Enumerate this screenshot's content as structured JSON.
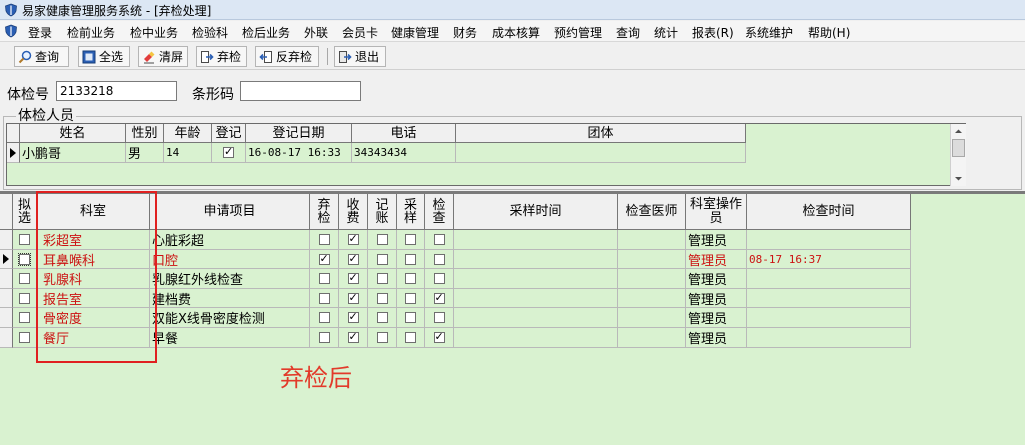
{
  "window": {
    "title": "易家健康管理服务系统 - [弃检处理]"
  },
  "menu": [
    "登录",
    "检前业务",
    "检中业务",
    "检验科",
    "检后业务",
    "外联",
    "会员卡",
    "健康管理",
    "财务",
    "成本核算",
    "预约管理",
    "查询",
    "统计",
    "报表(R)",
    "系统维护",
    "帮助(H)"
  ],
  "toolbar": {
    "query": "查询",
    "select_all": "全选",
    "clear": "清屏",
    "abandon": "弃检",
    "unabandon": "反弃检",
    "exit": "退出"
  },
  "search": {
    "exam_no_label": "体检号",
    "exam_no_value": "2133218",
    "barcode_label": "条形码",
    "barcode_value": ""
  },
  "patients": {
    "group_title": "体检人员",
    "headers": [
      "姓名",
      "性别",
      "年龄",
      "登记",
      "登记日期",
      "电话",
      "团体"
    ],
    "rows": [
      {
        "name": "小鹏哥",
        "gender": "男",
        "age": "14",
        "registered": true,
        "reg_date": "16-08-17 16:33",
        "phone": "34343434",
        "group": ""
      }
    ]
  },
  "items": {
    "headers": [
      "拟选",
      "科室",
      "申请项目",
      "弃检",
      "收费",
      "记账",
      "采样",
      "检查",
      "采样时间",
      "检查医师",
      "科室操作员",
      "检查时间"
    ],
    "rows": [
      {
        "selected": false,
        "dept": "彩超室",
        "item": "心脏彩超",
        "abandoned": false,
        "charged": true,
        "billed": false,
        "sampled": false,
        "checked": false,
        "sample_time": "",
        "doctor": "",
        "operator": "管理员",
        "check_time": "",
        "current": false
      },
      {
        "selected": false,
        "dept": "耳鼻喉科",
        "item": "口腔",
        "abandoned": true,
        "charged": true,
        "billed": false,
        "sampled": false,
        "checked": false,
        "sample_time": "",
        "doctor": "",
        "operator": "管理员",
        "check_time": "08-17 16:37",
        "current": true
      },
      {
        "selected": false,
        "dept": "乳腺科",
        "item": "乳腺红外线检查",
        "abandoned": false,
        "charged": true,
        "billed": false,
        "sampled": false,
        "checked": false,
        "sample_time": "",
        "doctor": "",
        "operator": "管理员",
        "check_time": "",
        "current": false
      },
      {
        "selected": false,
        "dept": "报告室",
        "item": "建档费",
        "abandoned": false,
        "charged": true,
        "billed": false,
        "sampled": false,
        "checked": true,
        "sample_time": "",
        "doctor": "",
        "operator": "管理员",
        "check_time": "",
        "current": false
      },
      {
        "selected": false,
        "dept": "骨密度",
        "item": "双能X线骨密度检测",
        "abandoned": false,
        "charged": true,
        "billed": false,
        "sampled": false,
        "checked": false,
        "sample_time": "",
        "doctor": "",
        "operator": "管理员",
        "check_time": "",
        "current": false
      },
      {
        "selected": false,
        "dept": "餐厅",
        "item": "早餐",
        "abandoned": false,
        "charged": true,
        "billed": false,
        "sampled": false,
        "checked": true,
        "sample_time": "",
        "doctor": "",
        "operator": "管理员",
        "check_time": "",
        "current": false
      }
    ]
  },
  "annotation": {
    "text": "弃检后"
  },
  "colors": {
    "grid_bg": "#d9f2d0",
    "dept_text": "#cc1111",
    "current_row_text": "#cc1111",
    "annotation": "#e23a2a"
  }
}
